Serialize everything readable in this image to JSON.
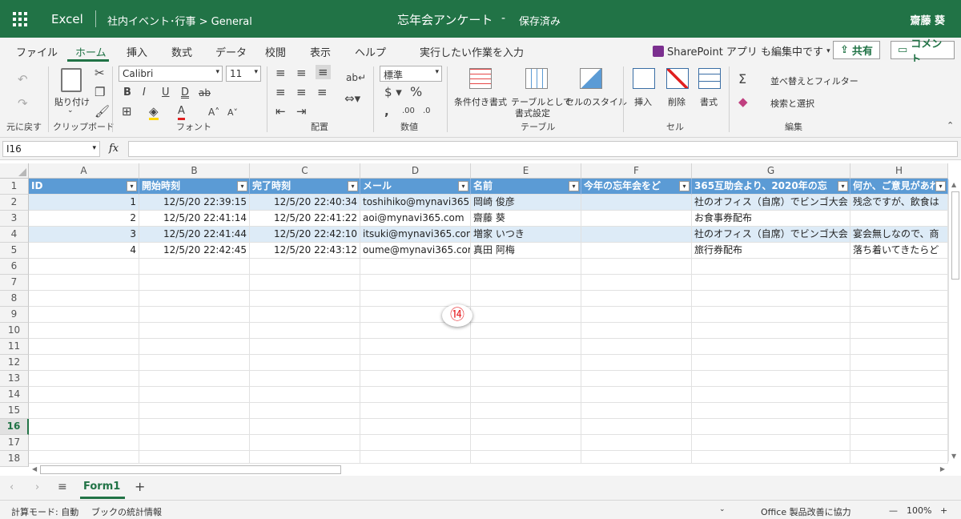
{
  "titlebar": {
    "app": "Excel",
    "breadcrumb": "社内イベント･行事 > General",
    "doc_title": "忘年会アンケート",
    "dash": "-",
    "save_status": "保存済み",
    "user": "齋藤 葵",
    "color": "#217346"
  },
  "menu": {
    "tabs": [
      "ファイル",
      "ホーム",
      "挿入",
      "数式",
      "データ",
      "校閲",
      "表示",
      "ヘルプ"
    ],
    "active_tab": "ホーム",
    "tell_me": "実行したい作業を入力",
    "sharepoint_notice": "SharePoint アプリ も編集中です",
    "share_label": "共有",
    "comment_label": "コメント"
  },
  "ribbon": {
    "undo_group": "元に戻す",
    "clipboard_group": "クリップボード",
    "paste_label": "貼り付け",
    "font_group": "フォント",
    "font_name": "Calibri",
    "font_size": "11",
    "align_group": "配置",
    "number_group": "数値",
    "number_format": "標準",
    "table_group": "テーブル",
    "cond_format": "条件付き書式",
    "format_as_table_1": "テーブルとして",
    "format_as_table_2": "書式設定",
    "cell_styles": "セルのスタイル",
    "cells_group": "セル",
    "insert": "挿入",
    "delete": "削除",
    "format": "書式",
    "edit_group": "編集",
    "sort_filter": "並べ替えとフィルター",
    "find_select": "検索と選択"
  },
  "formula_bar": {
    "name_box": "I16",
    "fx": "fx",
    "formula": ""
  },
  "grid": {
    "columns": [
      "A",
      "B",
      "C",
      "D",
      "E",
      "F",
      "G",
      "H"
    ],
    "rows": [
      "1",
      "2",
      "3",
      "4",
      "5",
      "6",
      "7",
      "8",
      "9",
      "10",
      "11",
      "12",
      "13",
      "14",
      "15",
      "16",
      "17",
      "18"
    ],
    "selected_row": "16",
    "headers": [
      "ID",
      "開始時刻",
      "完了時刻",
      "メール",
      "名前",
      "今年の忘年会をど",
      "365互助会より、2020年の忘",
      "何か、ご意見があれ"
    ],
    "data": [
      [
        "1",
        "12/5/20 22:39:15",
        "12/5/20 22:40:34",
        "toshihiko@mynavi365.",
        "岡崎 俊彦",
        "",
        "社のオフィス（自席）でビンゴ大会",
        "残念ですが、飲食は"
      ],
      [
        "2",
        "12/5/20 22:41:14",
        "12/5/20 22:41:22",
        "aoi@mynavi365.com",
        "齋藤 葵",
        "",
        "お食事券配布",
        ""
      ],
      [
        "3",
        "12/5/20 22:41:44",
        "12/5/20 22:42:10",
        "itsuki@mynavi365.com",
        "増家 いつき",
        "",
        "社のオフィス（自席）でビンゴ大会",
        "宴会無しなので、商"
      ],
      [
        "4",
        "12/5/20 22:42:45",
        "12/5/20 22:43:12",
        "oume@mynavi365.com",
        "真田 阿梅",
        "",
        "旅行券配布",
        "落ち着いてきたらど"
      ]
    ],
    "header_color": "#5b9bd5",
    "band_color": "#ddebf7",
    "annotation": "⑭"
  },
  "sheets": {
    "tabs": [
      "Form1"
    ],
    "add": "+"
  },
  "status": {
    "calc_mode": "計算モード: 自動",
    "stats": "ブックの統計情報",
    "improve": "Office 製品改善に協力",
    "minus": "—",
    "zoom": "100%",
    "plus": "+"
  }
}
